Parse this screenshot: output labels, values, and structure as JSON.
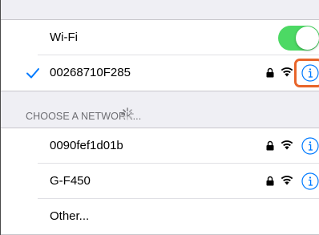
{
  "wifi_toggle": {
    "label": "Wi-Fi",
    "on": true
  },
  "connected_network": {
    "name": "00268710F285",
    "secured": true
  },
  "section_header": "CHOOSE A NETWORK...",
  "networks": [
    {
      "name": "0090fef1d01b",
      "secured": true
    },
    {
      "name": "G-F450",
      "secured": true
    }
  ],
  "other_label": "Other...",
  "colors": {
    "accent": "#007aff",
    "toggle_on": "#4cd964",
    "highlight": "#e8652a",
    "background": "#efeff4"
  },
  "icons": [
    "checkmark-icon",
    "lock-icon",
    "wifi-icon",
    "info-icon",
    "loading-spinner-icon"
  ]
}
